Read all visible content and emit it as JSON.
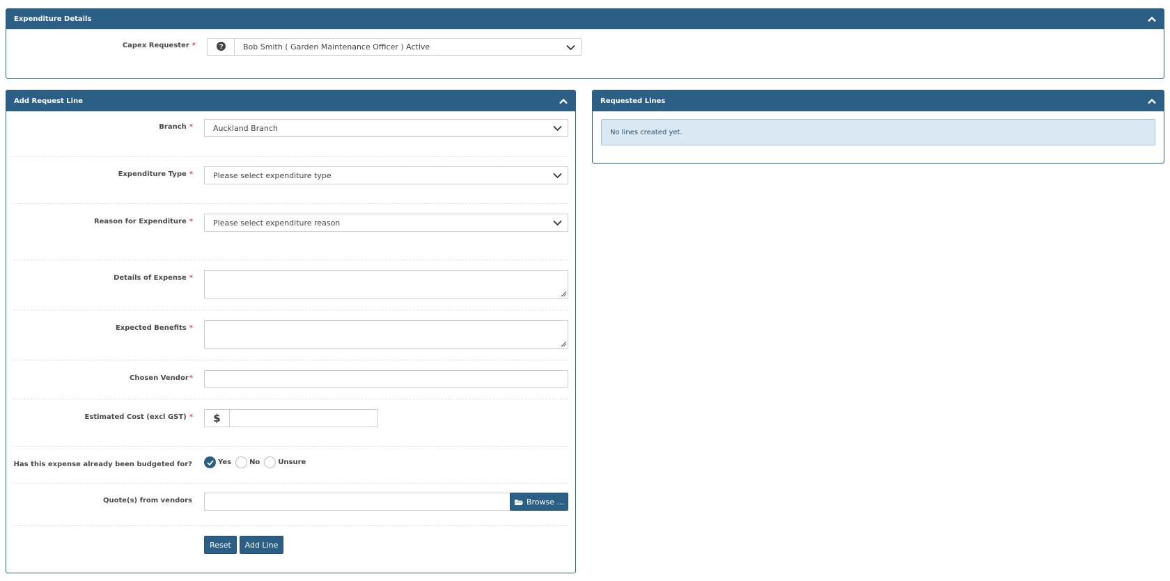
{
  "expenditure_details": {
    "title": "Expenditure Details",
    "capex_requester_label": "Capex Requester",
    "required_mark": "*",
    "capex_requester_value": "Bob Smith ( Garden Maintenance Officer ) Active",
    "help_icon": "question-circle-icon",
    "dropdown_icon": "chevron-down-icon"
  },
  "add_request_line": {
    "title": "Add Request Line",
    "branch_label": "Branch",
    "branch_value": "Auckland Branch",
    "expenditure_type_label": "Expenditure Type",
    "expenditure_type_placeholder": "Please select expenditure type",
    "reason_label": "Reason for Expenditure",
    "reason_placeholder": "Please select expenditure reason",
    "details_label": "Details of Expense",
    "benefits_label": "Expected Benefits",
    "vendor_label": "Chosen Vendor",
    "cost_label": "Estimated Cost (excl GST)",
    "currency_symbol": "$",
    "budgeted_label": "Has this expense already been budgeted for?",
    "budget_options": [
      "Yes",
      "No",
      "Unsure"
    ],
    "budget_selected": "Yes",
    "quotes_label": "Quote(s) from vendors",
    "browse_label": "Browse ...",
    "reset_label": "Reset",
    "add_line_label": "Add Line"
  },
  "requested_lines": {
    "title": "Requested Lines",
    "empty_message": "No lines created yet."
  },
  "colors": {
    "accent": "#2b5f86",
    "required": "#d9534f",
    "alert_bg": "#d9e8f3"
  }
}
